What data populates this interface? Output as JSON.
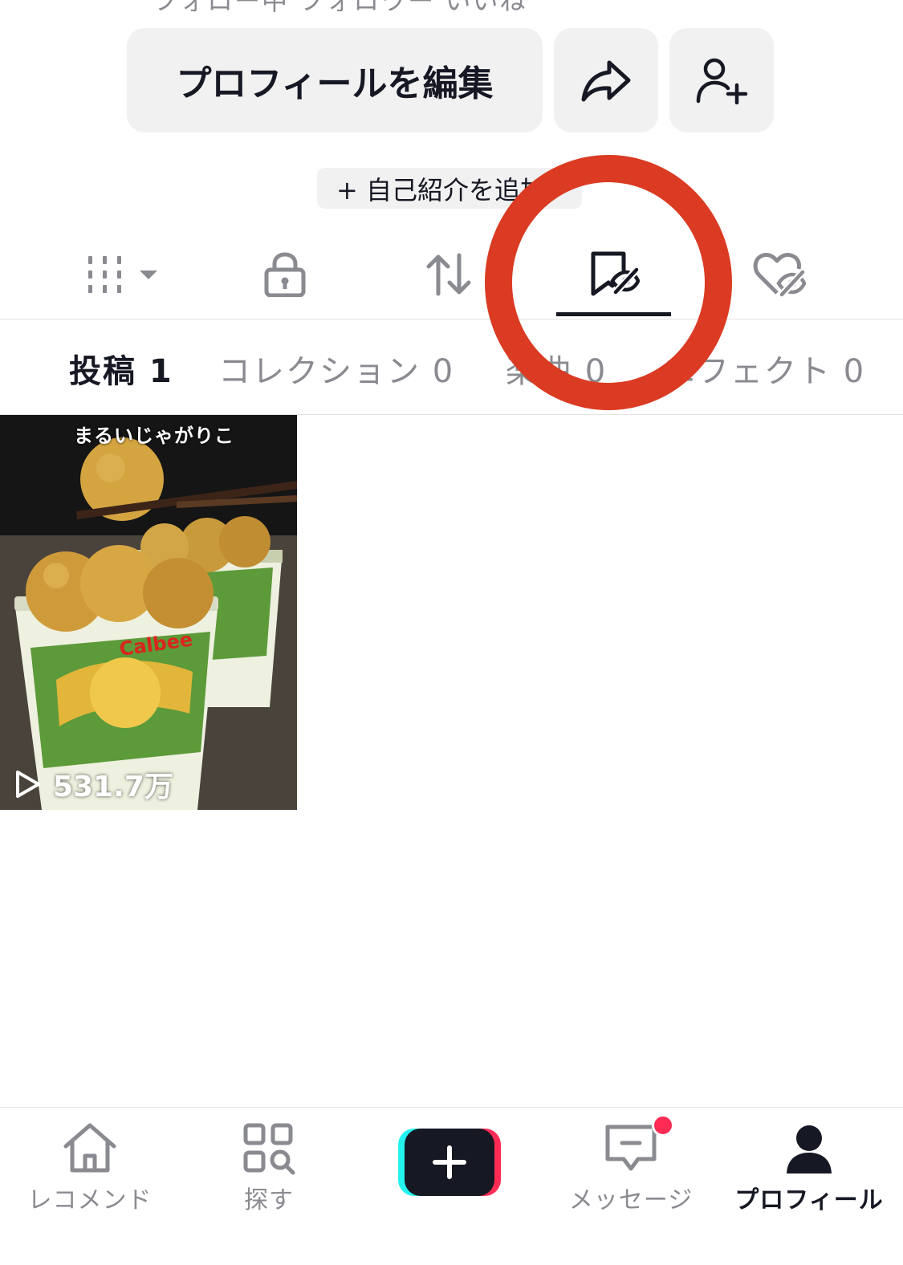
{
  "top_partial": "フォロー中 フォロワー いいね",
  "actions": {
    "edit_profile": "プロフィールを編集",
    "share_icon": "share-arrow-icon",
    "add_friend_icon": "add-user-icon"
  },
  "bio": {
    "add_label": "+ 自己紹介を追加"
  },
  "content_tabs": [
    {
      "icon": "grid-icon"
    },
    {
      "icon": "lock-icon"
    },
    {
      "icon": "repost-icon"
    },
    {
      "icon": "favorites-hidden-icon",
      "active": true
    },
    {
      "icon": "liked-hidden-icon"
    }
  ],
  "sub_tabs": [
    {
      "label": "投稿 1",
      "active": true
    },
    {
      "label": "コレクション 0"
    },
    {
      "label": "楽曲 0"
    },
    {
      "label": "エフェクト 0"
    }
  ],
  "videos": [
    {
      "caption": "まるいじゃがりこ",
      "views": "531.7万"
    }
  ],
  "bottom_nav": [
    {
      "label": "レコメンド",
      "icon": "home-icon"
    },
    {
      "label": "探す",
      "icon": "discover-icon"
    },
    {
      "label": "",
      "icon": "create-plus-icon"
    },
    {
      "label": "メッセージ",
      "icon": "inbox-icon",
      "badge": true
    },
    {
      "label": "プロフィール",
      "icon": "profile-icon",
      "active": true
    }
  ],
  "colors": {
    "annotation_circle": "#da3b22",
    "text_primary": "#161823",
    "text_secondary": "#8a8b91",
    "button_bg": "#f1f1f2",
    "badge": "#fe2c55",
    "create_cyan": "#25f4ee",
    "create_red": "#fe2c55"
  }
}
